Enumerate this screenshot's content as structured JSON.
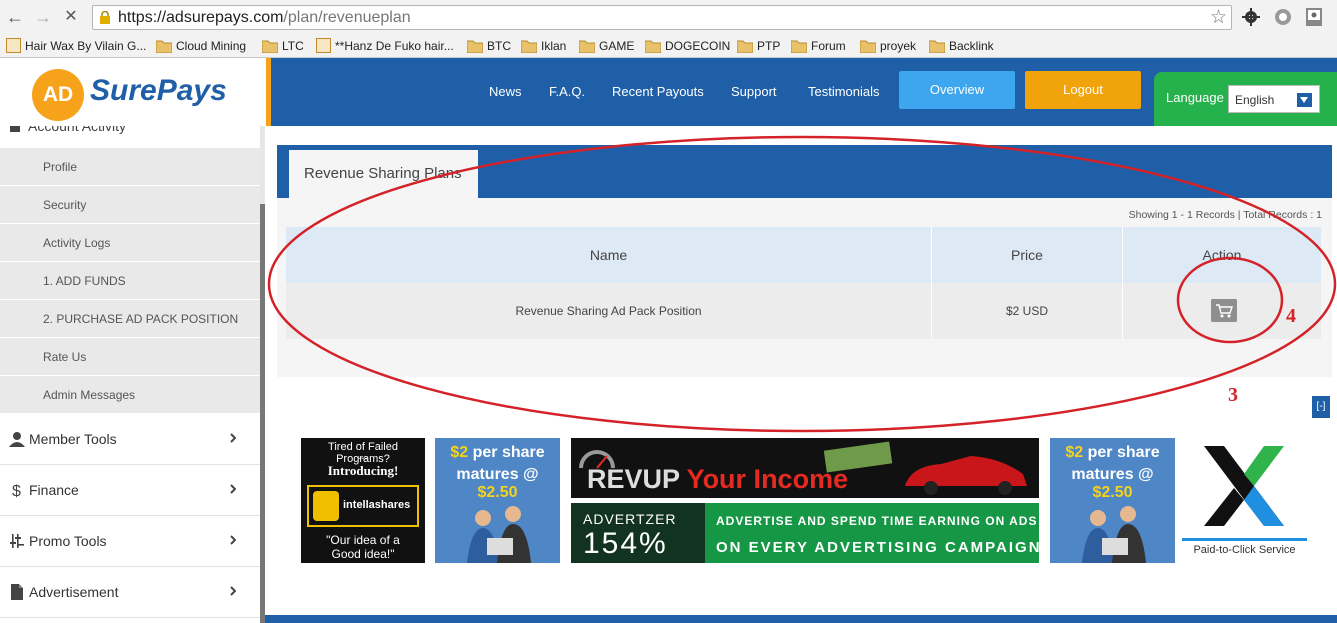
{
  "browser": {
    "url_host": "https://adsurepays.com",
    "url_path": "/plan/revenueplan",
    "bookmarks": [
      "Hair Wax By Vilain G...",
      "Cloud Mining",
      "LTC",
      "**Hanz De Fuko hair...",
      "BTC",
      "Iklan",
      "GAME",
      "DOGECOIN",
      "PTP",
      "Forum",
      "proyek",
      "Backlink"
    ],
    "icons": [
      "back-arrow-icon",
      "forward-arrow-icon",
      "stop-icon",
      "lock-icon",
      "star-icon",
      "gear-icon",
      "extension-icon",
      "account-icon"
    ]
  },
  "site": {
    "logo_ad": "AD",
    "logo_text": "SurePays",
    "nav": [
      "News",
      "F.A.Q.",
      "Recent Payouts",
      "Support",
      "Testimonials"
    ],
    "overview_label": "Overview",
    "logout_label": "Logout",
    "language_label": "Language",
    "language_value": "English"
  },
  "sidebar": {
    "partial_label": "Account Activity",
    "sub_items": [
      "Profile",
      "Security",
      "Activity Logs",
      "1. ADD FUNDS",
      "2. PURCHASE AD PACK POSITION",
      "Rate Us",
      "Admin Messages"
    ],
    "main_items": [
      {
        "label": "Member Tools",
        "icon": "user-icon"
      },
      {
        "label": "Finance",
        "icon": "dollar-icon"
      },
      {
        "label": "Promo Tools",
        "icon": "sliders-icon"
      },
      {
        "label": "Advertisement",
        "icon": "document-icon"
      }
    ]
  },
  "content": {
    "tab_label": "Revenue Sharing Plans",
    "showing": "Showing 1 - 1 Records | Total Records : 1",
    "columns": [
      "Name",
      "Price",
      "Action"
    ],
    "rows": [
      {
        "name": "Revenue Sharing Ad Pack Position",
        "price": "$2 USD",
        "action_icon": "cart-icon"
      }
    ],
    "collapse_label": "[-]"
  },
  "banners": {
    "b1": {
      "l1": "Tired of Failed Programs?",
      "l2": "---",
      "l3": "Introducing!",
      "l4": "intellashares",
      "l5": "\"Our idea of a",
      "l6": "Good idea!\""
    },
    "promo": {
      "price": "$2",
      "rest1": " per share",
      "rest2": "matures @ ",
      "mature": "$2.50"
    },
    "revup": {
      "a": "REVUP ",
      "b": "Your Income"
    },
    "advertzer": {
      "ad1": "ADVERTZER",
      "ad2": "154%",
      "r1": "ADVERTISE AND SPEND TIME EARNING ON ADS",
      "r2": "ON EVERY ADVERTISING CAMPAIGN"
    },
    "ptc": {
      "label": "Paid-to-Click Service"
    }
  },
  "annotations": {
    "n3": "3",
    "n4": "4",
    "color": "#d42228"
  }
}
